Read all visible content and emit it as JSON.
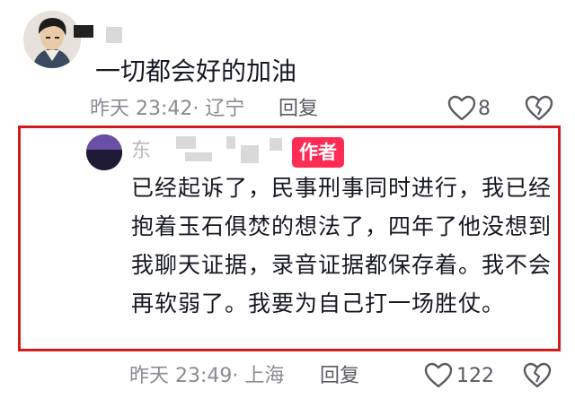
{
  "comment": {
    "text": "一切都会好的加油",
    "timestamp": "昨天 23:42",
    "location": "· 辽宁",
    "reply_label": "回复",
    "like_count": "8"
  },
  "reply": {
    "username_visible": "东",
    "author_badge": "作者",
    "text": "已经起诉了，民事刑事同时进行，我已经抱着玉石俱焚的想法了，四年了他没想到我聊天证据，录音证据都保存着。我不会再软弱了。我要为自己打一场胜仗。",
    "timestamp": "昨天 23:49",
    "location": "· 上海",
    "reply_label": "回复",
    "like_count": "122"
  },
  "colors": {
    "highlight_border": "#d41b1b",
    "author_badge_bg": "#fe2c55",
    "meta_text": "#8a8b91"
  },
  "icons": [
    "heart-outline-icon",
    "broken-heart-icon"
  ]
}
